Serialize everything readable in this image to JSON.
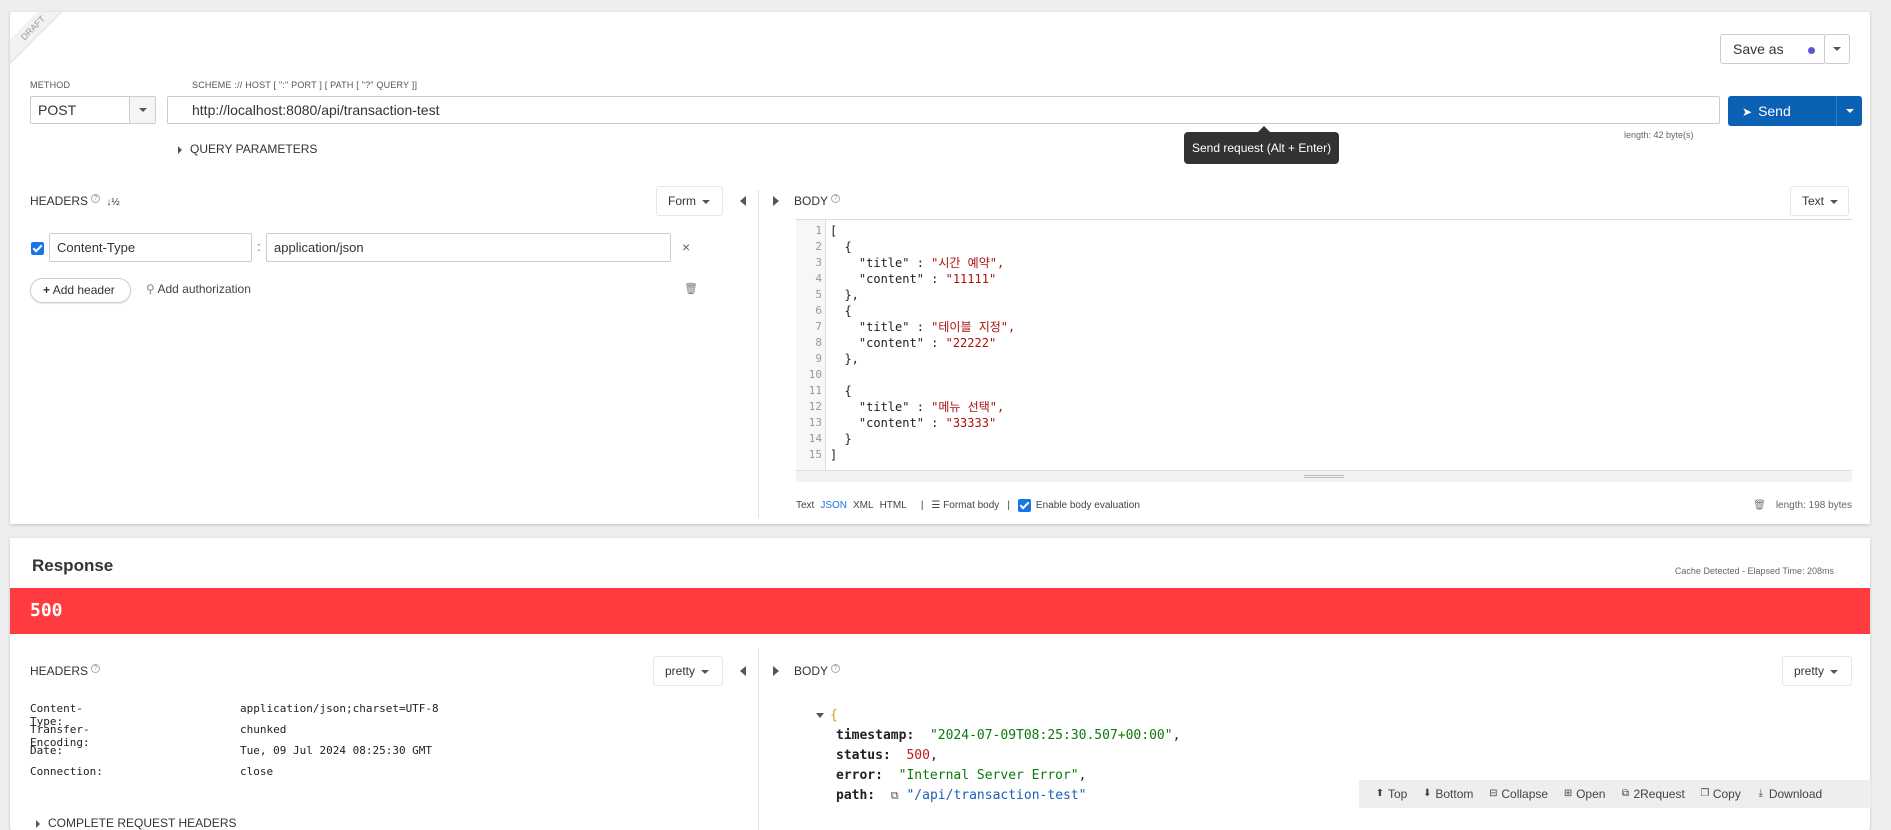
{
  "request": {
    "draft_badge": "DRAFT",
    "method_label": "METHOD",
    "method_value": "POST",
    "url_label": "SCHEME :// HOST [ \":\" PORT ] [ PATH [ \"?\" QUERY ]]",
    "url_value": "http://localhost:8080/api/transaction-test",
    "url_length": "length: 42 byte(s)",
    "save_as_label": "Save as",
    "send_label": "Send",
    "send_tooltip": "Send request (Alt + Enter)",
    "query_params_label": "QUERY PARAMETERS"
  },
  "req_headers": {
    "title": "HEADERS",
    "mode": "Form",
    "rows": [
      {
        "name": "Content-Type",
        "value": "application/json",
        "checked": true
      }
    ],
    "add_header_label": "Add header",
    "add_auth_label": "Add authorization"
  },
  "req_body": {
    "title": "BODY",
    "mode": "Text",
    "lines": [
      "[",
      "  {",
      "    \"title\" : \"시간 예약\",",
      "    \"content\" : \"11111\"",
      "  },",
      "  {",
      "    \"title\" : \"테이블 지정\",",
      "    \"content\" : \"22222\"",
      "  },",
      "",
      "  {",
      "    \"title\" : \"메뉴 선택\",",
      "    \"content\" : \"33333\"",
      "  }",
      "]"
    ],
    "formats": [
      "Text",
      "JSON",
      "XML",
      "HTML"
    ],
    "active_format": "JSON",
    "format_body_label": "Format body",
    "enable_eval_label": "Enable body evaluation",
    "length": "length: 198 bytes"
  },
  "response": {
    "title": "Response",
    "elapsed": "Cache Detected - Elapsed Time: 208ms",
    "status_code": "500",
    "status_color": "#ff3b3f",
    "headers_title": "HEADERS",
    "headers_mode": "pretty",
    "headers": [
      {
        "key": "Content-Type:",
        "value": "application/json;charset=UTF-8"
      },
      {
        "key": "Transfer-Encoding:",
        "value": "chunked"
      },
      {
        "key": "Date:",
        "value": "Tue, 09 Jul 2024 08:25:30 GMT"
      },
      {
        "key": "Connection:",
        "value": "close"
      }
    ],
    "complete_headers_label": "COMPLETE REQUEST HEADERS",
    "body_title": "BODY",
    "body_mode": "pretty",
    "body": {
      "open_brace": "{",
      "timestamp_key": "timestamp:",
      "timestamp_val": "\"2024-07-09T08:25:30.507+00:00\"",
      "status_key": "status:",
      "status_val": "500",
      "error_key": "error:",
      "error_val": "\"Internal Server Error\"",
      "path_key": "path:",
      "path_val": "\"/api/transaction-test\""
    },
    "toolbar": {
      "top": "Top",
      "bottom": "Bottom",
      "collapse": "Collapse",
      "open": "Open",
      "to_request": "2Request",
      "copy": "Copy",
      "download": "Download"
    }
  },
  "colors": {
    "send_blue": "#0b61b4",
    "error_red": "#ff3b3f",
    "link_blue": "#1a73e8"
  }
}
